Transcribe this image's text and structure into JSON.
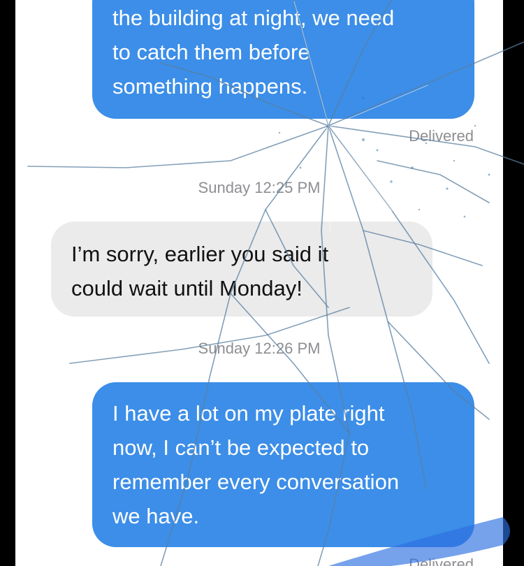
{
  "messages": [
    {
      "direction": "sent",
      "text": "the building at night, we need\nto catch them before\nsomething happens."
    },
    {
      "direction": "received",
      "text": "I’m sorry, earlier you said it\ncould wait until Monday!"
    },
    {
      "direction": "sent",
      "text": "I have a lot on my plate right\nnow, I can’t be expected to\nremember every conversation\nwe have."
    }
  ],
  "timestamps": [
    "Sunday 12:25 PM",
    "Sunday 12:26 PM"
  ],
  "status": [
    "Delivered",
    "Delivered"
  ],
  "colors": {
    "sent_bubble": "#3c8ee8",
    "received_bubble": "#ebebeb",
    "meta_text": "#8e8e93",
    "background": "#ffffff",
    "bezel": "#000000"
  }
}
